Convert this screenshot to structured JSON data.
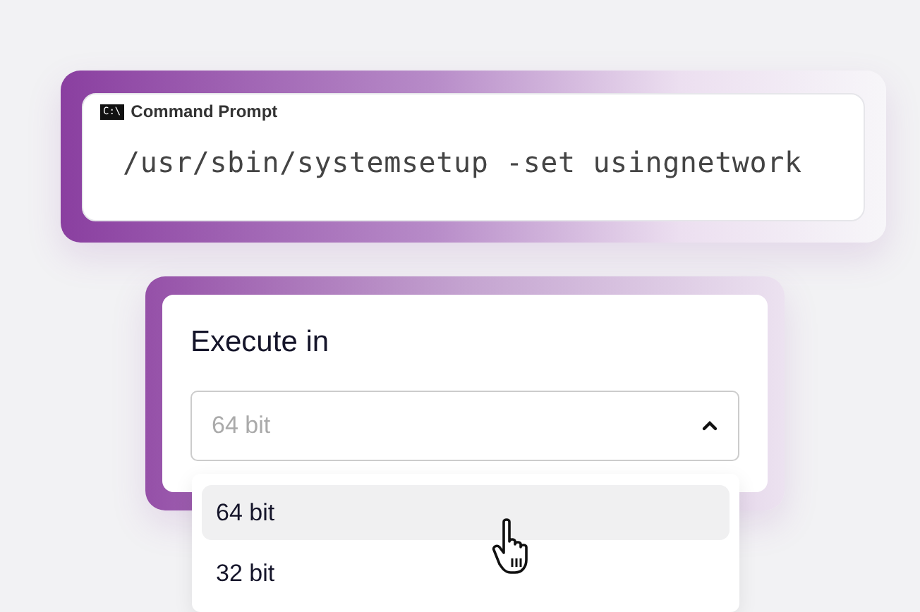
{
  "command_card": {
    "icon_text": "C:\\",
    "title": "Command Prompt",
    "command": "/usr/sbin/systemsetup -set usingnetwork"
  },
  "execute_card": {
    "heading": "Execute in",
    "select": {
      "placeholder": "64 bit",
      "expanded": true
    },
    "options": [
      {
        "label": "64 bit",
        "selected": true
      },
      {
        "label": "32 bit",
        "selected": false
      }
    ]
  }
}
